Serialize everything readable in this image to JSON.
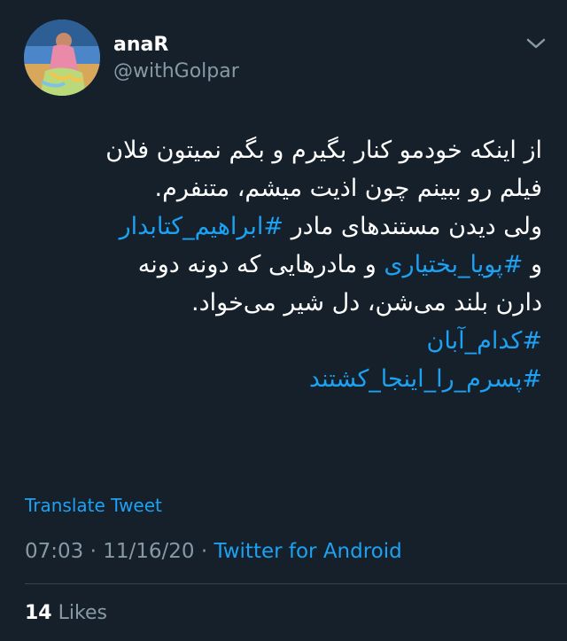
{
  "author": {
    "display_name": "anaR",
    "handle": "@withGolpar"
  },
  "tweet": {
    "lines": [
      [
        {
          "text": "از اینکه خودمو کنار بگیرم و بگم نمیتون فلان",
          "hashtag": false
        }
      ],
      [
        {
          "text": "فیلم رو ببینم چون اذیت میشم، متنفرم.",
          "hashtag": false
        }
      ],
      [
        {
          "text": "ولی دیدن مستندهای مادر ",
          "hashtag": false
        },
        {
          "text": "#ابراهیم_کتابدار",
          "hashtag": true
        }
      ],
      [
        {
          "text": "و ",
          "hashtag": false
        },
        {
          "text": "#پویا_بختیاری",
          "hashtag": true
        },
        {
          "text": " و مادرهایی که دونه دونه",
          "hashtag": false
        }
      ],
      [
        {
          "text": "دارن بلند می‌شن، دل شیر می‌خواد.",
          "hashtag": false
        }
      ],
      [
        {
          "text": "#کدام_آبان",
          "hashtag": true
        }
      ],
      [
        {
          "text": "#پسرم_را_اینجا_کشتند",
          "hashtag": true
        }
      ]
    ]
  },
  "translate_label": "Translate Tweet",
  "meta": {
    "time": "07:03",
    "date": "11/16/20",
    "separator": "·",
    "source": "Twitter for Android"
  },
  "stats": {
    "likes_count": "14",
    "likes_label": "Likes"
  },
  "icons": {
    "menu": "chevron-down-icon",
    "avatar": "profile-photo"
  },
  "colors": {
    "background": "#15202b",
    "accent": "#1da1f2",
    "muted": "#8899a6",
    "divider": "#38444d"
  }
}
